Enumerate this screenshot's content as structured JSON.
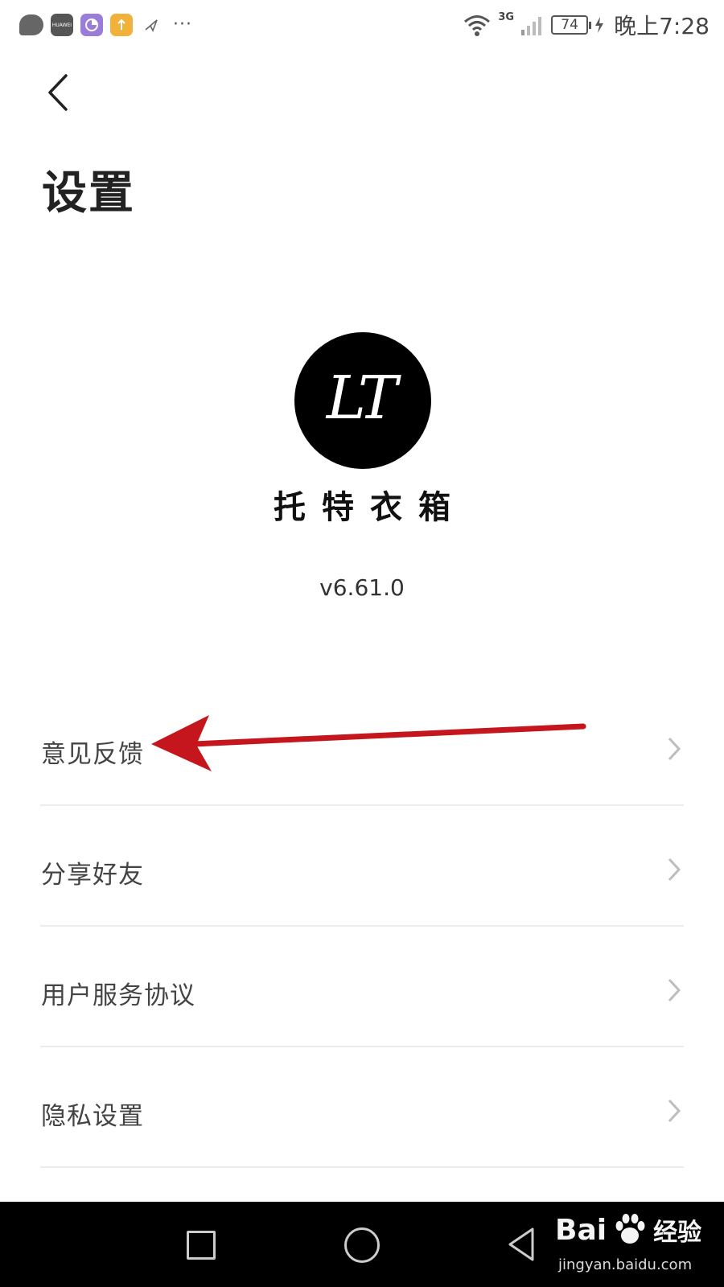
{
  "status_bar": {
    "huawei_label": "HUAWEI",
    "network": "3G",
    "battery": "74",
    "time": "晚上7:28",
    "more": "···"
  },
  "header": {
    "title": "设置"
  },
  "about": {
    "logo_text": "LT",
    "brand_name": "托特衣箱",
    "version": "v6.61.0"
  },
  "menu": {
    "items": [
      {
        "label": "意见反馈"
      },
      {
        "label": "分享好友"
      },
      {
        "label": "用户服务协议"
      },
      {
        "label": "隐私设置"
      }
    ]
  },
  "watermark": {
    "brand": "Bai",
    "brand_suffix": "经验",
    "url": "jingyan.baidu.com"
  },
  "colors": {
    "annotation_arrow": "#c4161c",
    "divider": "#ececec",
    "nav_bar": "#000000"
  }
}
